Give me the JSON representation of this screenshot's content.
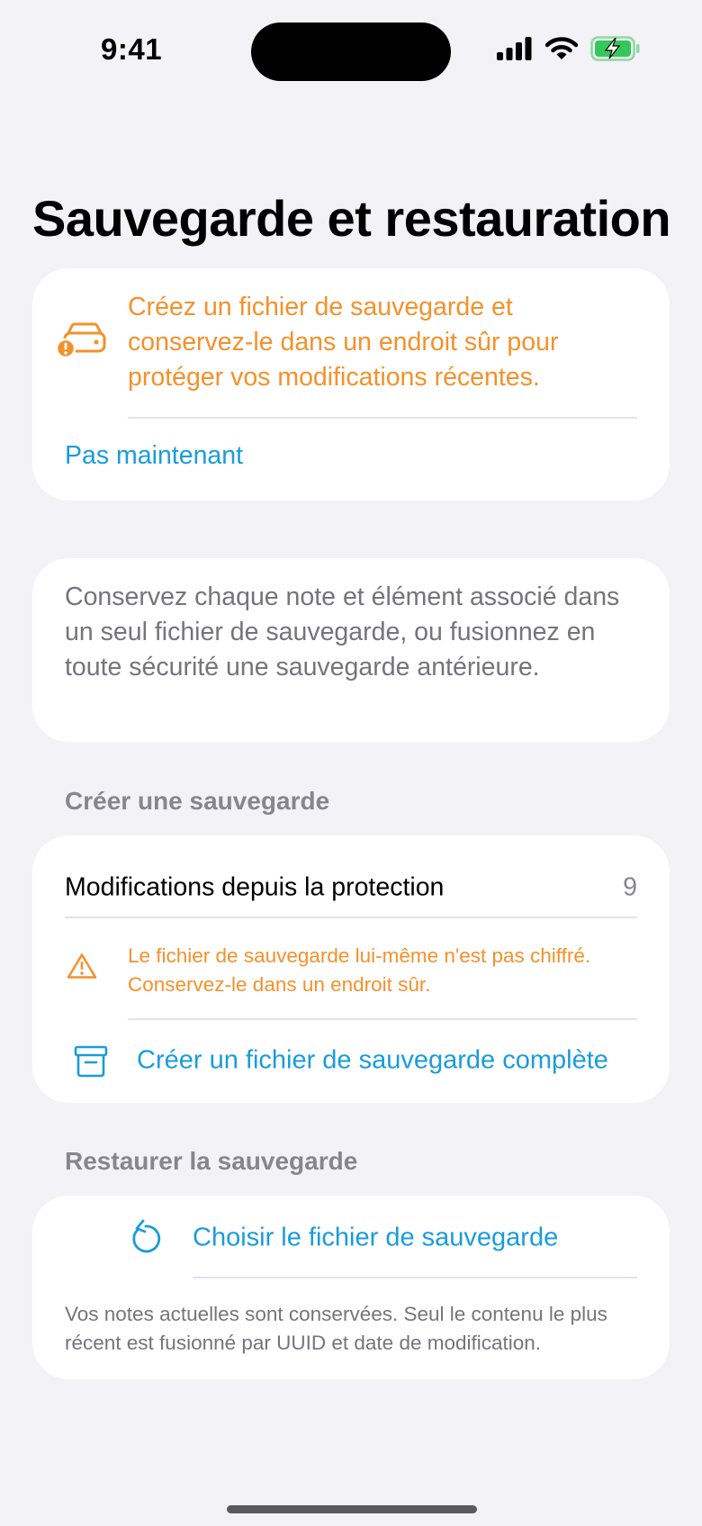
{
  "status_bar": {
    "time": "9:41"
  },
  "page": {
    "title": "Sauvegarde et restauration"
  },
  "alert_card": {
    "icon": "drive-alert-icon",
    "message": "Créez un fichier de sauvegarde et conservez-le dans un endroit sûr pour protéger vos modifications récentes.",
    "dismiss_label": "Pas maintenant"
  },
  "info_card": {
    "text": "Conservez chaque note et élément associé dans un seul fichier de sauvegarde, ou fusionnez en toute sécurité une sauvegarde antérieure."
  },
  "create_section": {
    "header": "Créer une sauvegarde",
    "changes_label": "Modifications depuis la protection",
    "changes_count": "9",
    "warning_text": "Le fichier de sauvegarde lui-même n'est pas chiffré. Conservez-le dans un endroit sûr.",
    "create_button_label": "Créer un fichier de sauvegarde complète"
  },
  "restore_section": {
    "header": "Restaurer la sauvegarde",
    "choose_button_label": "Choisir le fichier de sauvegarde",
    "footnote": "Vos notes actuelles sont conservées. Seul le contenu le plus récent est fusionné par UUID et date de modification."
  },
  "colors": {
    "accent_blue": "#1A9CDB",
    "warning_orange": "#F4912B",
    "battery_green": "#34C759",
    "background": "#F2F2F7"
  }
}
